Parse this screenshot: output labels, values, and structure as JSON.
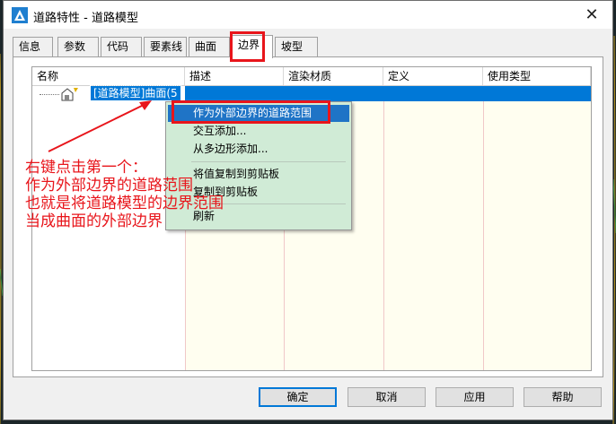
{
  "window": {
    "title": "道路特性 - 道路模型",
    "close_symbol": "✕"
  },
  "tabs": [
    {
      "label": "信息"
    },
    {
      "label": "参数"
    },
    {
      "label": "代码"
    },
    {
      "label": "要素线"
    },
    {
      "label": "曲面"
    },
    {
      "label": "边界",
      "active": true
    },
    {
      "label": "坡型"
    }
  ],
  "grid": {
    "columns": [
      "名称",
      "描述",
      "渲染材质",
      "定义",
      "使用类型"
    ],
    "row": {
      "name": "[道路模型]曲面(5"
    }
  },
  "context_menu": {
    "items": [
      {
        "label": "作为外部边界的道路范围",
        "highlighted": true
      },
      {
        "label": "交互添加..."
      },
      {
        "label": "从多边形添加..."
      },
      {
        "label": "将值复制到剪贴板"
      },
      {
        "label": "复制到剪贴板"
      },
      {
        "label": "刷新"
      }
    ]
  },
  "annotation": {
    "lines": [
      "右键点击第一个：",
      "作为外部边界的道路范围",
      "也就是将道路模型的边界范围",
      "当成曲面的外部边界"
    ],
    "color": "#e8151b"
  },
  "buttons": {
    "ok": "确定",
    "cancel": "取消",
    "apply": "应用",
    "help": "帮助"
  },
  "colors": {
    "selection": "#0078d7",
    "menu_bg": "#d0ebd6",
    "grid_bg": "#fffef0"
  }
}
